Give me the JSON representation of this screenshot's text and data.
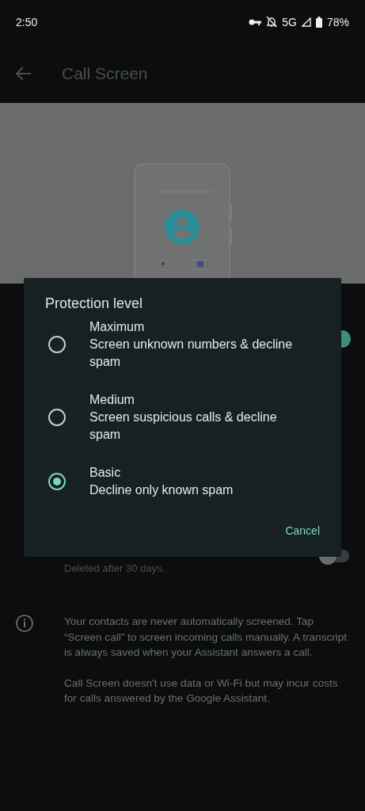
{
  "status_bar": {
    "time": "2:50",
    "network": "5G",
    "battery": "78%"
  },
  "app_bar": {
    "title": "Call Screen"
  },
  "illustration": {
    "kind": "picture"
  },
  "settings": [
    {
      "on": true
    },
    {
      "subtitle": "Deleted after 30 days.",
      "on": false
    }
  ],
  "info": [
    "Your contacts are never automatically screened. Tap “Screen call” to screen incoming calls manually. A transcript is always saved when your Assistant answers a call.",
    "Call Screen doesn't use data or Wi-Fi but may incur costs for calls answered by the Google Assistant."
  ],
  "dialog": {
    "title": "Protection level",
    "options": [
      {
        "label": "Maximum",
        "description": "Screen unknown numbers & decline spam",
        "selected": false
      },
      {
        "label": "Medium",
        "description": "Screen suspicious calls & decline spam",
        "selected": false
      },
      {
        "label": "Basic",
        "description": "Decline only known spam",
        "selected": true
      }
    ],
    "buttons": [
      "Cancel"
    ]
  }
}
